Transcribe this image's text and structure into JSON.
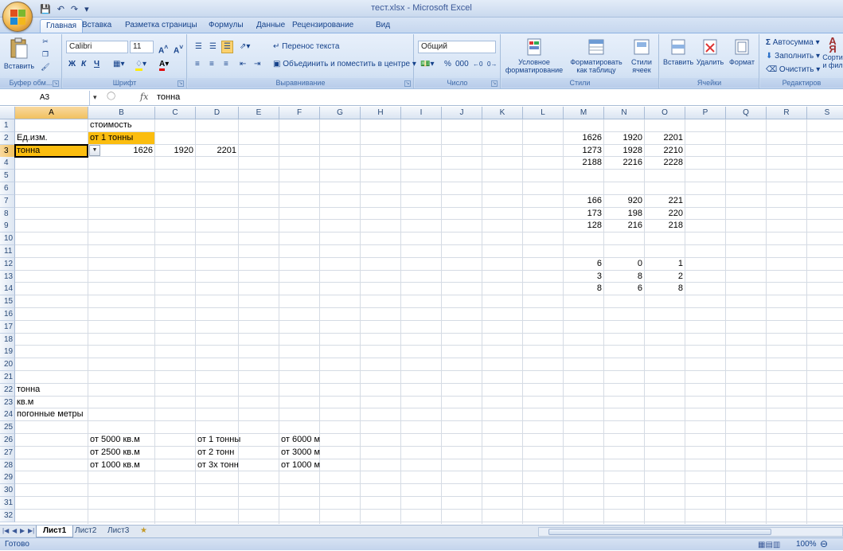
{
  "window": {
    "title": "тест.xlsx - Microsoft Excel"
  },
  "tabs": [
    "Главная",
    "Вставка",
    "Разметка страницы",
    "Формулы",
    "Данные",
    "Рецензирование",
    "Вид"
  ],
  "ribbon": {
    "clipboard": {
      "label": "Буфер обм...",
      "paste": "Вставить"
    },
    "font": {
      "label": "Шрифт",
      "name": "Calibri",
      "size": "11",
      "bold": "Ж",
      "italic": "К",
      "underline": "Ч"
    },
    "alignment": {
      "label": "Выравнивание",
      "wrap": "Перенос текста",
      "merge": "Объединить и поместить в центре"
    },
    "number": {
      "label": "Число",
      "format": "Общий",
      "percent": "%",
      "thousands": "000"
    },
    "styles": {
      "label": "Стили",
      "conditional": "Условное форматирование",
      "as_table": "Форматировать как таблицу",
      "cell_styles": "Стили ячеек"
    },
    "cells": {
      "label": "Ячейки",
      "insert": "Вставить",
      "delete": "Удалить",
      "format": "Формат"
    },
    "editing": {
      "label": "Редактиров",
      "autosum": "Автосумма",
      "fill": "Заполнить",
      "clear": "Очистить",
      "sort": "Сорти и фил"
    }
  },
  "formula_bar": {
    "name_box": "A3",
    "fx": "fx",
    "content": "тонна"
  },
  "columns": [
    "A",
    "B",
    "C",
    "D",
    "E",
    "F",
    "G",
    "H",
    "I",
    "J",
    "K",
    "L",
    "M",
    "N",
    "O",
    "P",
    "Q",
    "R",
    "S"
  ],
  "rows": [
    "1",
    "2",
    "3",
    "4",
    "5",
    "6",
    "7",
    "8",
    "9",
    "10",
    "11",
    "12",
    "13",
    "14",
    "15",
    "16",
    "17",
    "18",
    "19",
    "20",
    "21",
    "22",
    "23",
    "24",
    "25",
    "26",
    "27",
    "28",
    "29",
    "30",
    "31",
    "32"
  ],
  "cells": [
    {
      "ref": "B1",
      "row": 1,
      "col": "B",
      "v": "стоимость"
    },
    {
      "ref": "A2",
      "row": 2,
      "col": "A",
      "v": "Ед.изм."
    },
    {
      "ref": "B2",
      "row": 2,
      "col": "B",
      "v": "от 1 тонны",
      "fill": "#fbbd0f"
    },
    {
      "ref": "A3",
      "row": 3,
      "col": "A",
      "v": "тонна",
      "fill": "#fbbd0f"
    },
    {
      "ref": "B3",
      "row": 3,
      "col": "B",
      "v": "1626",
      "num": true
    },
    {
      "ref": "C3",
      "row": 3,
      "col": "C",
      "v": "1920",
      "num": true
    },
    {
      "ref": "D3",
      "row": 3,
      "col": "D",
      "v": "2201",
      "num": true
    },
    {
      "ref": "M2",
      "row": 2,
      "col": "M",
      "v": "1626",
      "num": true
    },
    {
      "ref": "N2",
      "row": 2,
      "col": "N",
      "v": "1920",
      "num": true
    },
    {
      "ref": "O2",
      "row": 2,
      "col": "O",
      "v": "2201",
      "num": true
    },
    {
      "ref": "M3",
      "row": 3,
      "col": "M",
      "v": "1273",
      "num": true
    },
    {
      "ref": "N3",
      "row": 3,
      "col": "N",
      "v": "1928",
      "num": true
    },
    {
      "ref": "O3",
      "row": 3,
      "col": "O",
      "v": "2210",
      "num": true
    },
    {
      "ref": "M4",
      "row": 4,
      "col": "M",
      "v": "2188",
      "num": true
    },
    {
      "ref": "N4",
      "row": 4,
      "col": "N",
      "v": "2216",
      "num": true
    },
    {
      "ref": "O4",
      "row": 4,
      "col": "O",
      "v": "2228",
      "num": true
    },
    {
      "ref": "M7",
      "row": 7,
      "col": "M",
      "v": "166",
      "num": true
    },
    {
      "ref": "N7",
      "row": 7,
      "col": "N",
      "v": "920",
      "num": true
    },
    {
      "ref": "O7",
      "row": 7,
      "col": "O",
      "v": "221",
      "num": true
    },
    {
      "ref": "M8",
      "row": 8,
      "col": "M",
      "v": "173",
      "num": true
    },
    {
      "ref": "N8",
      "row": 8,
      "col": "N",
      "v": "198",
      "num": true
    },
    {
      "ref": "O8",
      "row": 8,
      "col": "O",
      "v": "220",
      "num": true
    },
    {
      "ref": "M9",
      "row": 9,
      "col": "M",
      "v": "128",
      "num": true
    },
    {
      "ref": "N9",
      "row": 9,
      "col": "N",
      "v": "216",
      "num": true
    },
    {
      "ref": "O9",
      "row": 9,
      "col": "O",
      "v": "218",
      "num": true
    },
    {
      "ref": "M12",
      "row": 12,
      "col": "M",
      "v": "6",
      "num": true
    },
    {
      "ref": "N12",
      "row": 12,
      "col": "N",
      "v": "0",
      "num": true
    },
    {
      "ref": "O12",
      "row": 12,
      "col": "O",
      "v": "1",
      "num": true
    },
    {
      "ref": "M13",
      "row": 13,
      "col": "M",
      "v": "3",
      "num": true
    },
    {
      "ref": "N13",
      "row": 13,
      "col": "N",
      "v": "8",
      "num": true
    },
    {
      "ref": "O13",
      "row": 13,
      "col": "O",
      "v": "2",
      "num": true
    },
    {
      "ref": "M14",
      "row": 14,
      "col": "M",
      "v": "8",
      "num": true
    },
    {
      "ref": "N14",
      "row": 14,
      "col": "N",
      "v": "6",
      "num": true
    },
    {
      "ref": "O14",
      "row": 14,
      "col": "O",
      "v": "8",
      "num": true
    },
    {
      "ref": "A22",
      "row": 22,
      "col": "A",
      "v": "тонна"
    },
    {
      "ref": "A23",
      "row": 23,
      "col": "A",
      "v": "кв.м"
    },
    {
      "ref": "A24",
      "row": 24,
      "col": "A",
      "v": "погонные метры"
    },
    {
      "ref": "B26",
      "row": 26,
      "col": "B",
      "v": "от 5000 кв.м"
    },
    {
      "ref": "D26",
      "row": 26,
      "col": "D",
      "v": "от 1 тонны"
    },
    {
      "ref": "F26",
      "row": 26,
      "col": "F",
      "v": "от 6000 м"
    },
    {
      "ref": "B27",
      "row": 27,
      "col": "B",
      "v": "от 2500 кв.м"
    },
    {
      "ref": "D27",
      "row": 27,
      "col": "D",
      "v": "от 2 тонн"
    },
    {
      "ref": "F27",
      "row": 27,
      "col": "F",
      "v": "от 3000 м"
    },
    {
      "ref": "B28",
      "row": 28,
      "col": "B",
      "v": "от 1000 кв.м"
    },
    {
      "ref": "D28",
      "row": 28,
      "col": "D",
      "v": "от 3х тонн"
    },
    {
      "ref": "F28",
      "row": 28,
      "col": "F",
      "v": "от 1000 м"
    }
  ],
  "selected": {
    "row": 3,
    "col": "A"
  },
  "sheets": [
    "Лист1",
    "Лист2",
    "Лист3"
  ],
  "active_sheet": "Лист1",
  "status": {
    "text": "Готово",
    "zoom": "100%"
  }
}
